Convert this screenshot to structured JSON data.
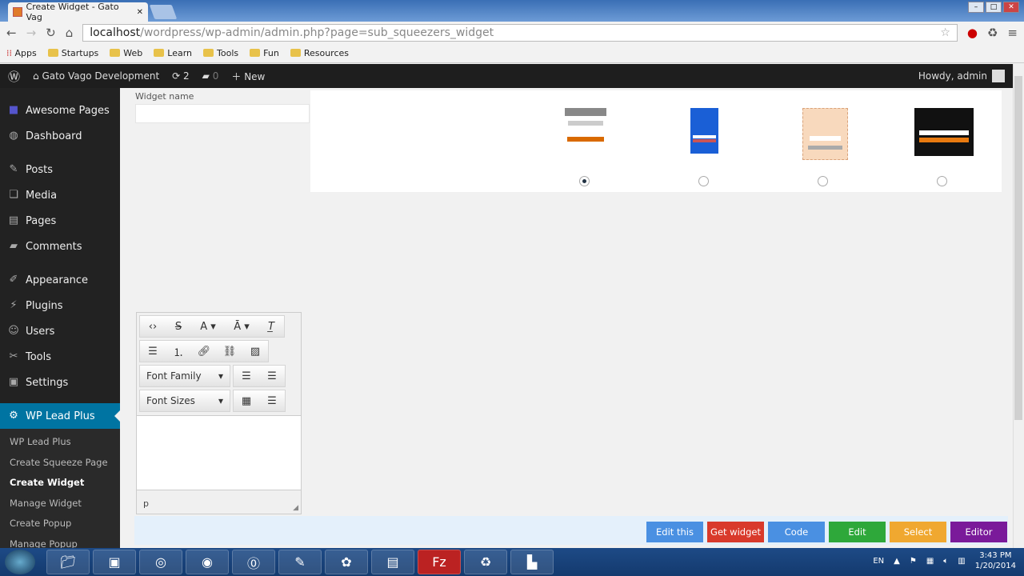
{
  "browser": {
    "tab_title": "Create Widget - Gato Vag",
    "url_host": "localhost",
    "url_path": "/wordpress/wp-admin/admin.php?page=sub_squeezers_widget",
    "bookmarks": [
      "Apps",
      "Startups",
      "Web",
      "Learn",
      "Tools",
      "Fun",
      "Resources"
    ]
  },
  "adminbar": {
    "site": "Gato Vago Development",
    "updates": "2",
    "comments": "0",
    "new": "New",
    "howdy": "Howdy, admin"
  },
  "sidebar": {
    "items": [
      {
        "label": "Awesome Pages",
        "icon": "■"
      },
      {
        "label": "Dashboard",
        "icon": "◍"
      },
      {
        "label": "Posts",
        "icon": "✎"
      },
      {
        "label": "Media",
        "icon": "❏"
      },
      {
        "label": "Pages",
        "icon": "▤"
      },
      {
        "label": "Comments",
        "icon": "▰"
      },
      {
        "label": "Appearance",
        "icon": "✐"
      },
      {
        "label": "Plugins",
        "icon": "⚡"
      },
      {
        "label": "Users",
        "icon": "☺"
      },
      {
        "label": "Tools",
        "icon": "✂"
      },
      {
        "label": "Settings",
        "icon": "▣"
      },
      {
        "label": "WP Lead Plus",
        "icon": "⚙"
      }
    ],
    "submenu": [
      "WP Lead Plus",
      "Create Squeeze Page",
      "Create Widget",
      "Manage Widget",
      "Create Popup",
      "Manage Popup"
    ]
  },
  "form": {
    "widget_name_label": "Widget name",
    "widget_name_value": "",
    "selected_template": 1
  },
  "editor": {
    "font_family": "Font Family",
    "font_sizes": "Font Sizes",
    "path": "p"
  },
  "actions": [
    {
      "label": "Edit this",
      "color": "#4a90e2"
    },
    {
      "label": "Get widget",
      "color": "#d93a2b"
    },
    {
      "label": "Code",
      "color": "#4a90e2"
    },
    {
      "label": "Edit",
      "color": "#2ea83a"
    },
    {
      "label": "Select",
      "color": "#f0a830"
    },
    {
      "label": "Editor",
      "color": "#7a1a9a"
    }
  ],
  "taskbar": {
    "lang": "EN",
    "time": "3:43 PM",
    "date": "1/20/2014"
  }
}
